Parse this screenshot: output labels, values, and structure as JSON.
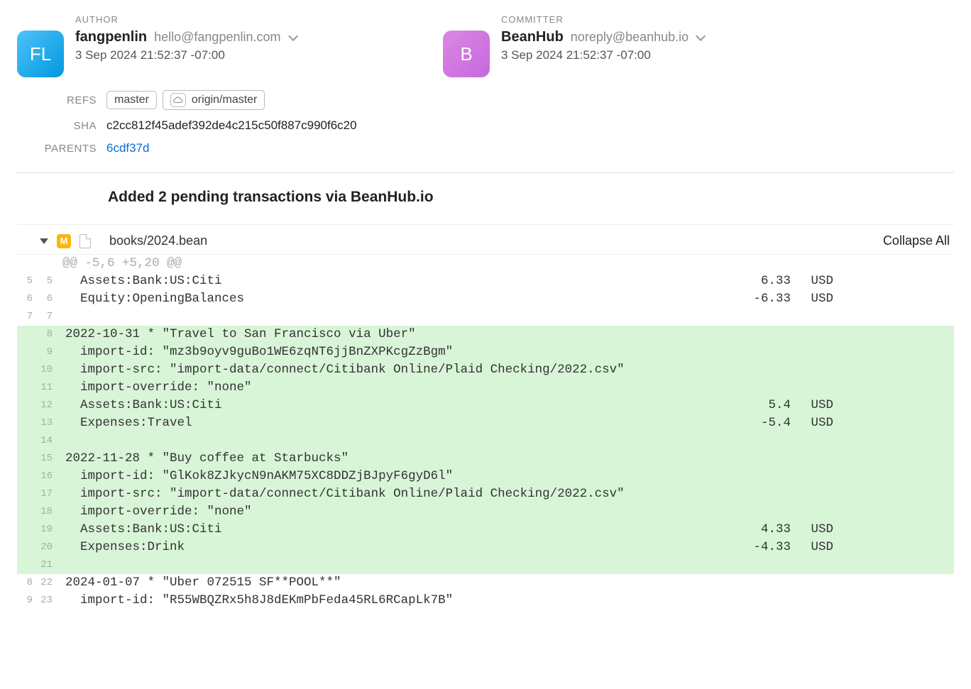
{
  "author": {
    "role": "AUTHOR",
    "initials": "FL",
    "name": "fangpenlin",
    "email": "hello@fangpenlin.com",
    "date": "3 Sep 2024 21:52:37 -07:00"
  },
  "committer": {
    "role": "COMMITTER",
    "initials": "B",
    "name": "BeanHub",
    "email": "noreply@beanhub.io",
    "date": "3 Sep 2024 21:52:37 -07:00"
  },
  "meta": {
    "refs_label": "REFS",
    "ref_local": "master",
    "ref_remote": "origin/master",
    "sha_label": "SHA",
    "sha": "c2cc812f45adef392de4c215c50f887c990f6c20",
    "parents_label": "PARENTS",
    "parent": "6cdf37d"
  },
  "commit_message": "Added 2 pending transactions via BeanHub.io",
  "file": {
    "badge": "M",
    "path": "books/2024.bean",
    "collapse_all": "Collapse All"
  },
  "diff": {
    "hunk": "@@ -5,6 +5,20 @@",
    "lines": [
      {
        "ol": "5",
        "nl": "5",
        "type": "ctx",
        "text": "  Assets:Bank:US:Citi",
        "amount": "6.33",
        "cur": "USD"
      },
      {
        "ol": "6",
        "nl": "6",
        "type": "ctx",
        "text": "  Equity:OpeningBalances",
        "amount": "-6.33",
        "cur": "USD"
      },
      {
        "ol": "7",
        "nl": "7",
        "type": "ctx",
        "text": ""
      },
      {
        "ol": "",
        "nl": "8",
        "type": "added",
        "text": "2022-10-31 * \"Travel to San Francisco via Uber\""
      },
      {
        "ol": "",
        "nl": "9",
        "type": "added",
        "text": "  import-id: \"mz3b9oyv9guBo1WE6zqNT6jjBnZXPKcgZzBgm\""
      },
      {
        "ol": "",
        "nl": "10",
        "type": "added",
        "text": "  import-src: \"import-data/connect/Citibank Online/Plaid Checking/2022.csv\""
      },
      {
        "ol": "",
        "nl": "11",
        "type": "added",
        "text": "  import-override: \"none\""
      },
      {
        "ol": "",
        "nl": "12",
        "type": "added",
        "text": "  Assets:Bank:US:Citi",
        "amount": "5.4",
        "cur": "USD"
      },
      {
        "ol": "",
        "nl": "13",
        "type": "added",
        "text": "  Expenses:Travel",
        "amount": "-5.4",
        "cur": "USD"
      },
      {
        "ol": "",
        "nl": "14",
        "type": "added",
        "text": ""
      },
      {
        "ol": "",
        "nl": "15",
        "type": "added",
        "text": "2022-11-28 * \"Buy coffee at Starbucks\""
      },
      {
        "ol": "",
        "nl": "16",
        "type": "added",
        "text": "  import-id: \"GlKok8ZJkycN9nAKM75XC8DDZjBJpyF6gyD6l\""
      },
      {
        "ol": "",
        "nl": "17",
        "type": "added",
        "text": "  import-src: \"import-data/connect/Citibank Online/Plaid Checking/2022.csv\""
      },
      {
        "ol": "",
        "nl": "18",
        "type": "added",
        "text": "  import-override: \"none\""
      },
      {
        "ol": "",
        "nl": "19",
        "type": "added",
        "text": "  Assets:Bank:US:Citi",
        "amount": "4.33",
        "cur": "USD"
      },
      {
        "ol": "",
        "nl": "20",
        "type": "added",
        "text": "  Expenses:Drink",
        "amount": "-4.33",
        "cur": "USD"
      },
      {
        "ol": "",
        "nl": "21",
        "type": "added",
        "text": ""
      },
      {
        "ol": "8",
        "nl": "22",
        "type": "ctx",
        "text": "2024-01-07 * \"Uber 072515 SF**POOL**\""
      },
      {
        "ol": "9",
        "nl": "23",
        "type": "ctx",
        "text": "  import-id: \"R55WBQZRx5h8J8dEKmPbFeda45RL6RCapLk7B\""
      }
    ]
  }
}
